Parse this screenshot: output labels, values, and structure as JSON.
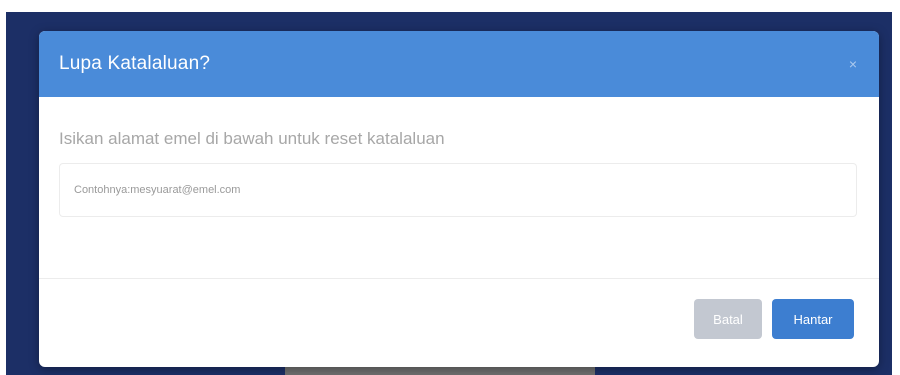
{
  "modal": {
    "title": "Lupa Katalaluan?",
    "close_symbol": "×",
    "instruction": "Isikan alamat emel di bawah untuk reset katalaluan",
    "email_placeholder": "Contohnya:mesyuarat@emel.com",
    "cancel_label": "Batal",
    "submit_label": "Hantar"
  },
  "colors": {
    "header": "#4a8bd9",
    "submit": "#3d7ed0",
    "cancel": "#c3c8d1",
    "backdrop": "#1c2f66"
  }
}
